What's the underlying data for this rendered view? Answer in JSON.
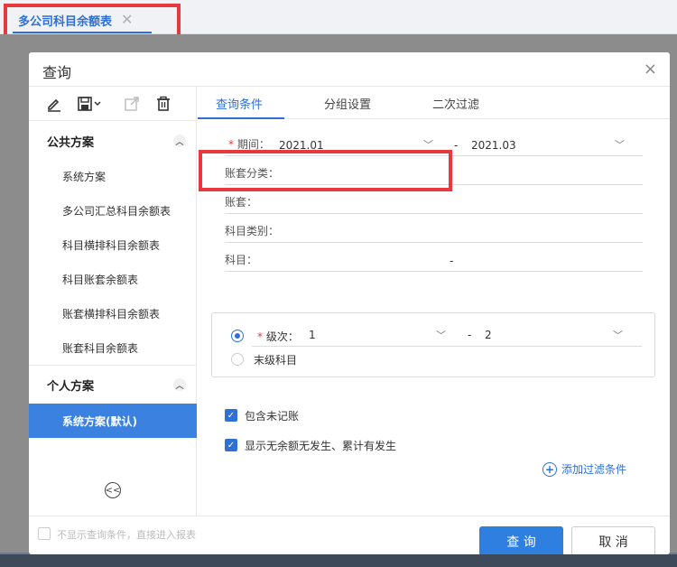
{
  "tab": {
    "label": "多公司科目余额表",
    "close": "✕"
  },
  "dialog": {
    "title": "查询",
    "close": "×"
  },
  "toolbar": {
    "edit_icon": "edit-icon",
    "save_icon": "save-icon",
    "export_icon": "share-icon",
    "delete_icon": "delete-icon"
  },
  "public_plans": {
    "header": "公共方案",
    "items": [
      "系统方案",
      "多公司汇总科目余额表",
      "科目横排科目余额表",
      "科目账套余额表",
      "账套横排科目余额表",
      "账套科目余额表"
    ]
  },
  "personal_plans": {
    "header": "个人方案",
    "items": [
      "系统方案(默认)"
    ]
  },
  "query_tabs": [
    "查询条件",
    "分组设置",
    "二次过滤"
  ],
  "form": {
    "period_label": "期间：",
    "period_from": "2021.01",
    "period_sep": "-",
    "period_to": "2021.03",
    "book_category_label": "账套分类：",
    "book_label": "账套：",
    "account_type_label": "科目类别：",
    "account_label": "科目：",
    "account_sep": "-",
    "level_label": "级次：",
    "level_from": "1",
    "level_sep": "-",
    "level_to": "2",
    "leaf_label": "末级科目",
    "include_unposted": "包含未记账",
    "show_zero": "显示无余额无发生、累计有发生",
    "add_filter": "添加过滤条件"
  },
  "footer": {
    "skip_text": "不显示查询条件，直接进入报表",
    "query_button": "查 询",
    "cancel_button": "取 消"
  },
  "colors": {
    "accent": "#2f6fd6",
    "highlight": "#e8393c",
    "active_item": "#3b82e0"
  }
}
